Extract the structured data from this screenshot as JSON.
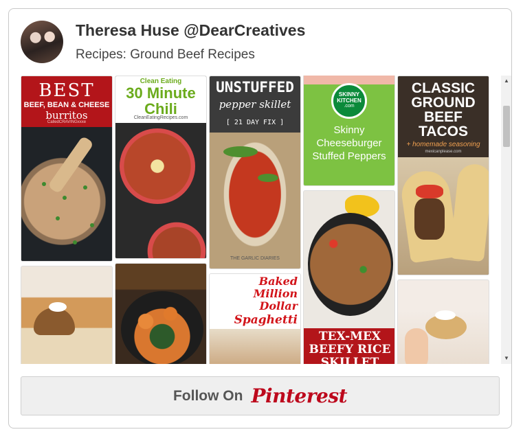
{
  "profile": {
    "name": "Theresa Huse @DearCreatives",
    "board": "Recipes: Ground Beef Recipes"
  },
  "pins": {
    "burritos": {
      "line1": "BEST",
      "line2": "BEEF, BEAN & CHEESE",
      "line3": "burritos",
      "credit": "CalledCRAVINGxxxe"
    },
    "chili": {
      "line1": "Clean Eating",
      "line2": "30 Minute",
      "line3": "Chili",
      "credit": "CleanEatingRecipes.com"
    },
    "skillet": {
      "line1": "UNSTUFFED",
      "line2": "pepper skillet",
      "line3": "[ 21 DAY FIX ]",
      "credit": "THE GARLIC DIARIES"
    },
    "cheeseburger": {
      "badge1": "SKINNY",
      "badge2": "KITCHEN",
      "badge3": ".com",
      "line1": "Skinny",
      "line2": "Cheeseburger",
      "line3": "Stuffed Peppers"
    },
    "tacos": {
      "line1": "CLASSIC",
      "line2": "GROUND",
      "line3": "BEEF",
      "line4": "TACOS",
      "line5": "+ homemade seasoning",
      "credit": "mexicanplease.com"
    },
    "spaghetti": {
      "line1": "Baked",
      "line2": "Million",
      "line3": "Dollar",
      "line4": "Spaghetti"
    },
    "texmex": {
      "line1": "TEX-MEX",
      "line2": "BEEFY RICE",
      "line3": "SKILLET"
    }
  },
  "follow": {
    "label": "Follow On",
    "logo": "Pinterest"
  },
  "colors": {
    "pinterest_red": "#bd081c",
    "text_dark": "#333333"
  }
}
